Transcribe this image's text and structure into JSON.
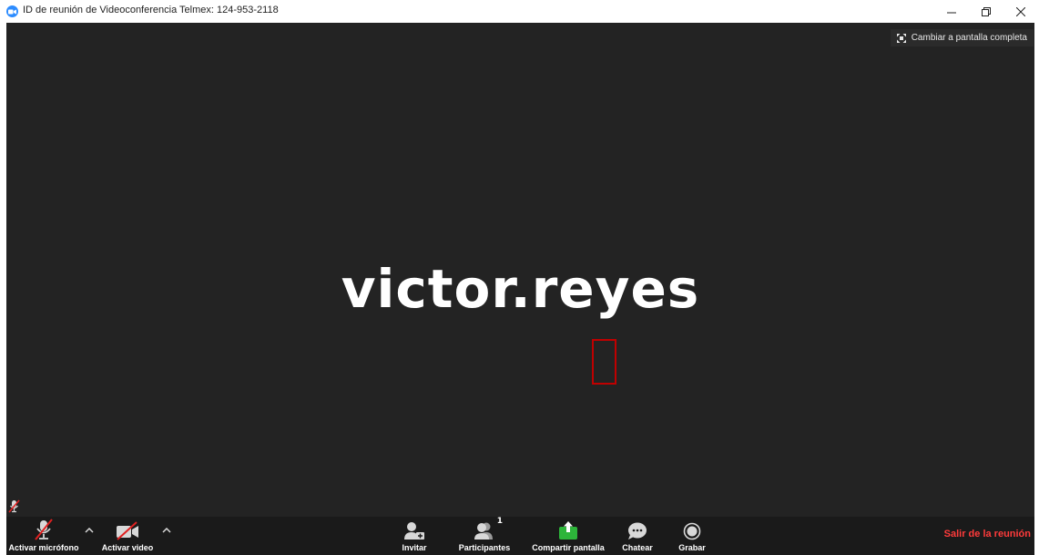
{
  "window": {
    "title": "ID de reunión de Videoconferencia Telmex: 124-953-2118",
    "controls": {
      "minimize": "–",
      "restore": "❐",
      "close": "✕"
    }
  },
  "video": {
    "fullscreen_label": "Cambiar a pantalla completa",
    "participant_name": "victor.reyes"
  },
  "toolbar": {
    "mic_label": "Activar micrófono",
    "video_label": "Activar video",
    "invite_label": "Invitar",
    "participants_label": "Participantes",
    "participants_count": "1",
    "share_label": "Compartir pantalla",
    "chat_label": "Chatear",
    "record_label": "Grabar",
    "leave_label": "Salir de la reunión"
  },
  "colors": {
    "app_blue": "#2d8cff",
    "share_green": "#2db53a",
    "leave_red": "#ff3b3b",
    "video_bg": "#232323",
    "toolbar_bg": "#1a1a1a"
  }
}
